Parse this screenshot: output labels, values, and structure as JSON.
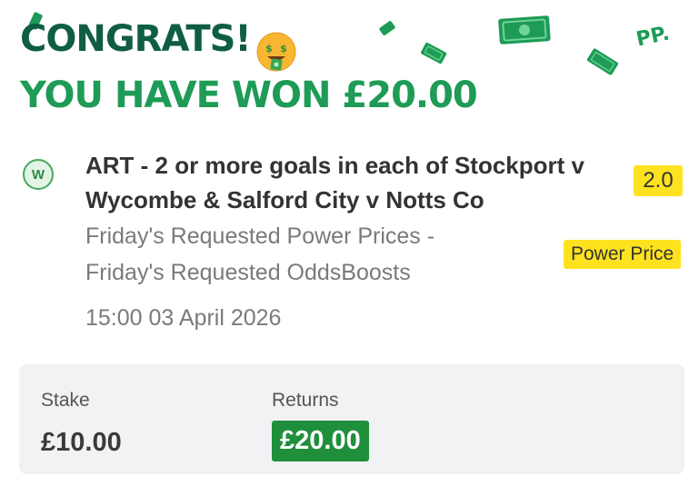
{
  "header": {
    "congrats": "CONGRATS!",
    "won_line": "YOU HAVE WON £20.00",
    "emoji_icon": "money-mouth-face",
    "brand_mark": "PP."
  },
  "bet": {
    "result_letter": "W",
    "selection": "ART - 2 or more goals in each of Stockport v Wycombe & Salford City v Notts Co",
    "market_line1": "Friday's Requested Power Prices -",
    "market_line2": "Friday's Requested OddsBoosts",
    "datetime": "15:00 03 April 2026",
    "odds": "2.0",
    "price_tag": "Power Price"
  },
  "summary": {
    "stake_label": "Stake",
    "stake_value": "£10.00",
    "returns_label": "Returns",
    "returns_value": "£20.00"
  },
  "colors": {
    "brand_dark_green": "#0f5e43",
    "brand_green": "#1e9b56",
    "highlight_yellow": "#ffe21f",
    "returns_green": "#1f8f3c",
    "panel_bg": "#f1f2f4"
  }
}
